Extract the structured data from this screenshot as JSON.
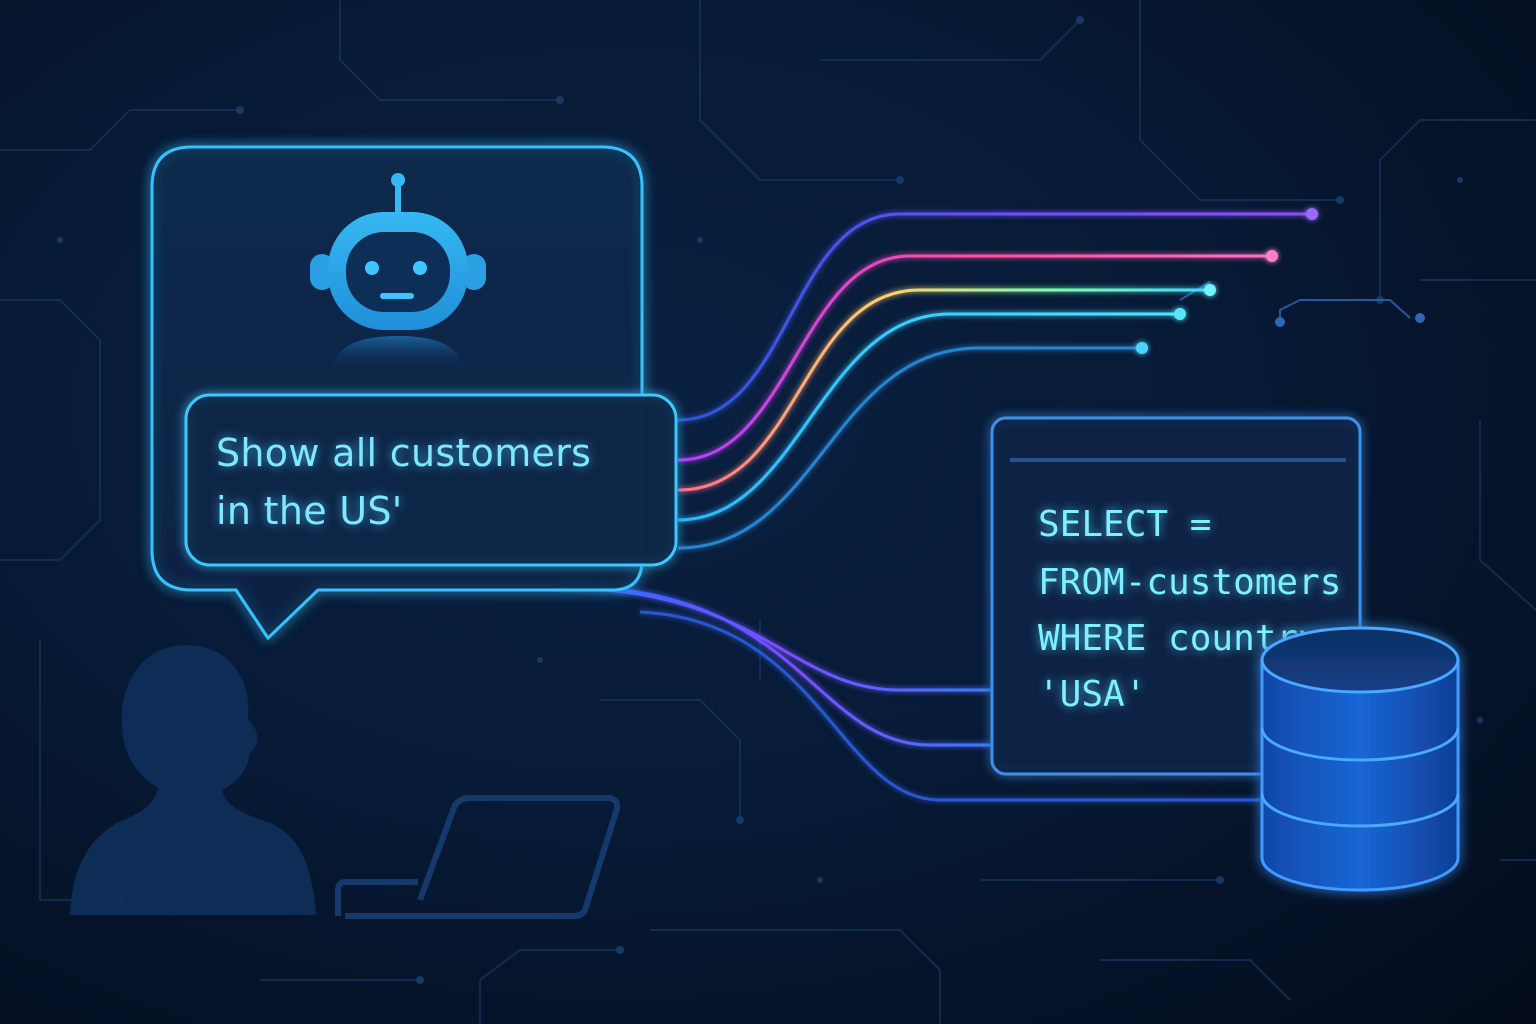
{
  "chat": {
    "query_line_1": "Show all customers",
    "query_line_2": "in the US'"
  },
  "sql": {
    "line_1": "SELECT =",
    "line_2": "FROM-customers",
    "line_3": "WHERE country =",
    "line_4": "'USA'"
  },
  "icons": {
    "assistant": "robot-icon",
    "user": "person-silhouette-icon",
    "device": "laptop-icon",
    "storage": "database-icon"
  },
  "colors": {
    "background": "#061226",
    "accent_cyan": "#39c6ff",
    "accent_blue": "#2d6cff",
    "accent_purple": "#7b4dff",
    "accent_pink": "#ff4fa0",
    "text_glow": "#7fe7ff"
  }
}
